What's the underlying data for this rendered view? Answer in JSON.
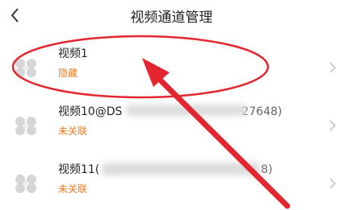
{
  "header": {
    "title": "视频通道管理",
    "back_icon": "chevron-left-icon"
  },
  "channels": [
    {
      "name": "视频1",
      "status": "隐藏"
    },
    {
      "name": "视频10@DS",
      "name_tail": "27648)",
      "status": "未关联"
    },
    {
      "name": "视频11(",
      "name_tail": "8)",
      "status": "未关联"
    }
  ],
  "colors": {
    "status": "#f07a1c",
    "annotation": "#e3262f"
  },
  "icons": {
    "channel": "camera-fan-icon",
    "row_arrow": "chevron-right-icon"
  }
}
